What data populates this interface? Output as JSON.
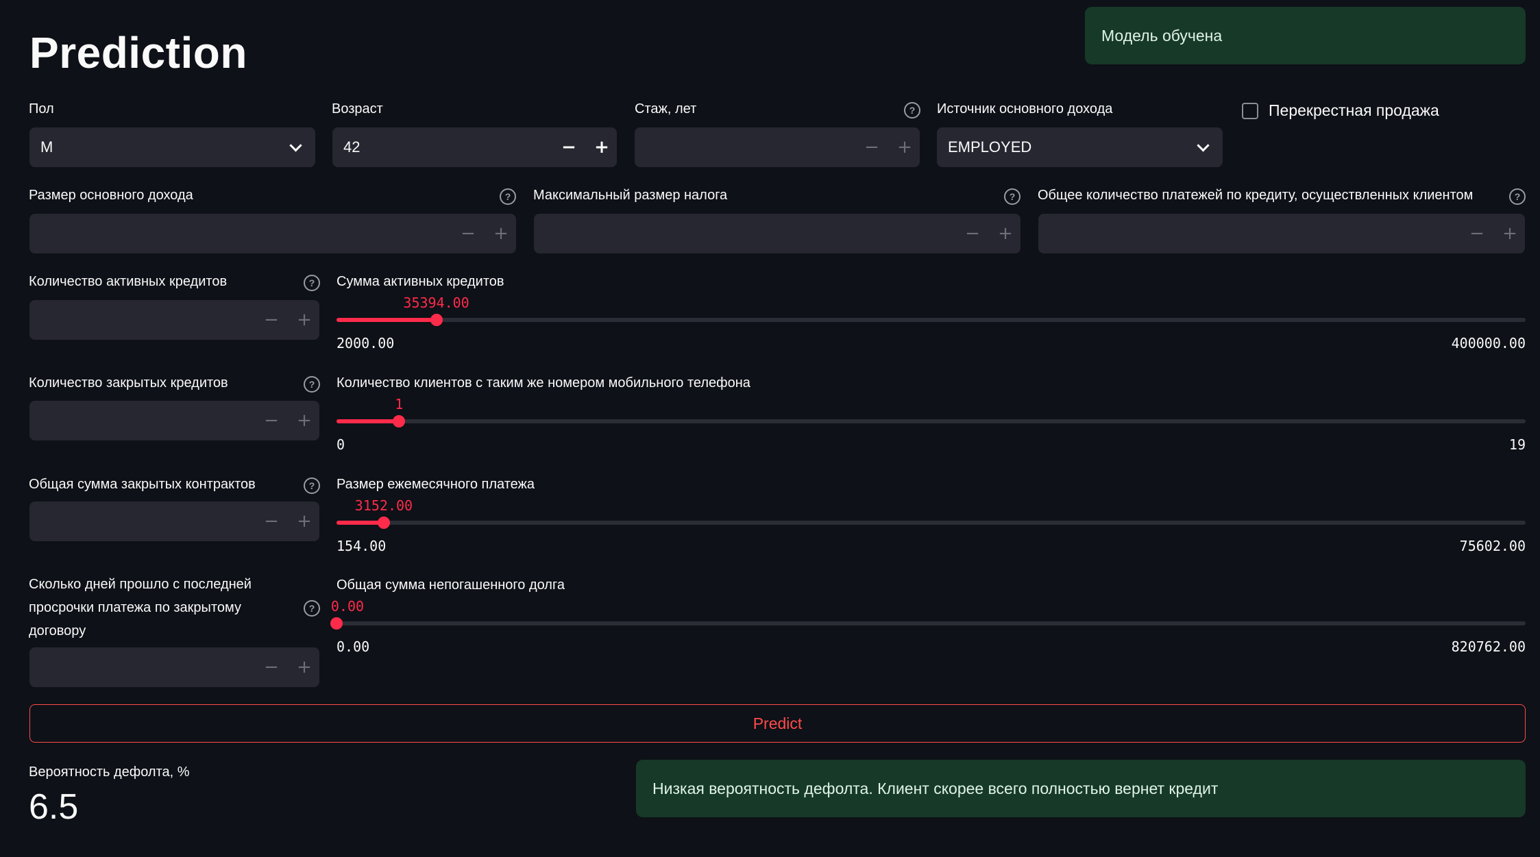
{
  "title": "Prediction",
  "toast": "Модель обучена",
  "fields": {
    "gender": {
      "label": "Пол",
      "value": "M"
    },
    "age": {
      "label": "Возраст",
      "value": "42"
    },
    "experience": {
      "label": "Стаж, лет",
      "value": ""
    },
    "income_source": {
      "label": "Источник основного дохода",
      "value": "EMPLOYED"
    },
    "cross_sell": {
      "label": "Перекрестная продажа",
      "checked": false
    },
    "income": {
      "label": "Размер основного дохода",
      "value": ""
    },
    "max_tax": {
      "label": "Максимальный размер налога",
      "value": ""
    },
    "total_payments": {
      "label": "Общее количество платежей по кредиту, осуществленных клиентом",
      "value": ""
    },
    "active_loans_count": {
      "label": "Количество активных кредитов",
      "value": ""
    },
    "closed_loans_count": {
      "label": "Количество закрытых кредитов",
      "value": ""
    },
    "closed_contracts_sum": {
      "label": "Общая сумма закрытых контрактов",
      "value": ""
    },
    "days_since_overdue": {
      "label": "Сколько дней прошло с последней просрочки платежа по закрытому договору",
      "value": ""
    }
  },
  "sliders": {
    "active_loans_sum": {
      "label": "Сумма активных кредитов",
      "value": 35394.0,
      "value_text": "35394.00",
      "min_text": "2000.00",
      "max_text": "400000.00",
      "min": 2000,
      "max": 400000
    },
    "same_phone_clients": {
      "label": "Количество клиентов с таким же номером мобильного телефона",
      "value": 1,
      "value_text": "1",
      "min_text": "0",
      "max_text": "19",
      "min": 0,
      "max": 19
    },
    "monthly_payment": {
      "label": "Размер ежемесячного платежа",
      "value": 3152.0,
      "value_text": "3152.00",
      "min_text": "154.00",
      "max_text": "75602.00",
      "min": 154,
      "max": 75602
    },
    "outstanding_debt": {
      "label": "Общая сумма непогашенного долга",
      "value": 0.0,
      "value_text": "0.00",
      "min_text": "0.00",
      "max_text": "820762.00",
      "min": 0,
      "max": 820762
    }
  },
  "predict_label": "Predict",
  "result": {
    "label": "Вероятность дефолта, %",
    "value": "6.5",
    "message": "Низкая вероятность дефолта. Клиент скорее всего полностью вернет кредит"
  },
  "colors": {
    "accent": "#ff2b4b",
    "background": "#0e1117",
    "input_bg": "#262730",
    "success_bg": "#173928"
  }
}
